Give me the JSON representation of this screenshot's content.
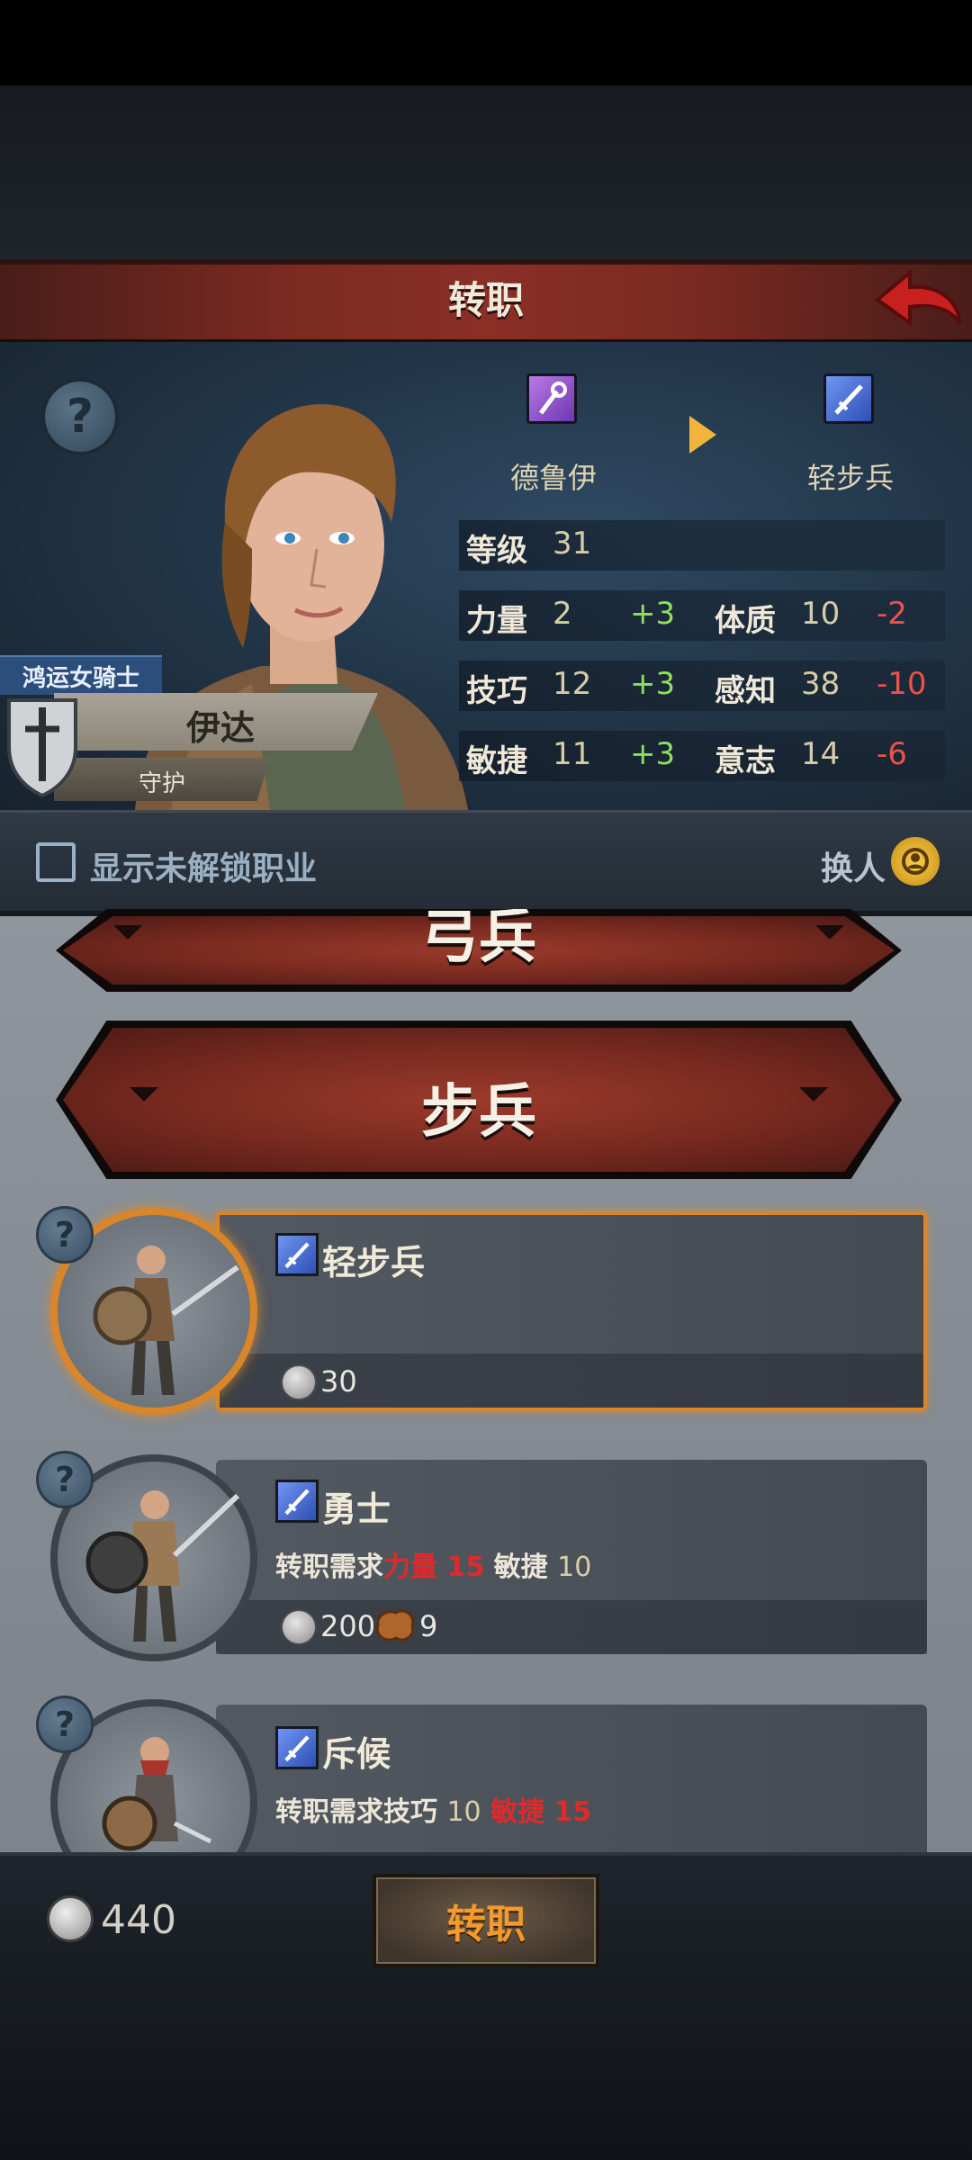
{
  "header": {
    "title": "转职"
  },
  "hero": {
    "title_tag": "鸿运女骑士",
    "name": "伊达",
    "role": "守护"
  },
  "class_change": {
    "from": "德鲁伊",
    "to": "轻步兵"
  },
  "stats": {
    "level_label": "等级",
    "level_value": "31",
    "rows": [
      {
        "left_label": "力量",
        "left_value": "2",
        "left_delta": "+3",
        "right_label": "体质",
        "right_value": "10",
        "right_delta": "-2"
      },
      {
        "left_label": "技巧",
        "left_value": "12",
        "left_delta": "+3",
        "right_label": "感知",
        "right_value": "38",
        "right_delta": "-10"
      },
      {
        "left_label": "敏捷",
        "left_value": "11",
        "left_delta": "+3",
        "right_label": "意志",
        "right_value": "14",
        "right_delta": "-6"
      }
    ]
  },
  "options": {
    "show_locked_label": "显示未解锁职业",
    "show_locked_checked": false,
    "switch_label": "换人"
  },
  "categories": {
    "archer": "弓兵",
    "infantry": "步兵"
  },
  "units": [
    {
      "name": "轻步兵",
      "selected": true,
      "cost": "30"
    },
    {
      "name": "勇士",
      "selected": false,
      "req_label": "转职需求",
      "req1_label": "力量",
      "req1_value": "15",
      "req2_label": "敏捷",
      "req2_value": "10",
      "cost": "200",
      "item_count": "9"
    },
    {
      "name": "斥候",
      "selected": false,
      "req_label": "转职需求",
      "req1_label": "技巧",
      "req1_value": "10",
      "req2_label": "敏捷",
      "req2_value": "15"
    }
  ],
  "footer": {
    "coins": "440",
    "confirm_label": "转职"
  },
  "colors": {
    "accent_orange": "#d9852a",
    "positive_green": "#8ee05d",
    "negative_red": "#ee5148",
    "requirement_red": "#e02a2a"
  }
}
